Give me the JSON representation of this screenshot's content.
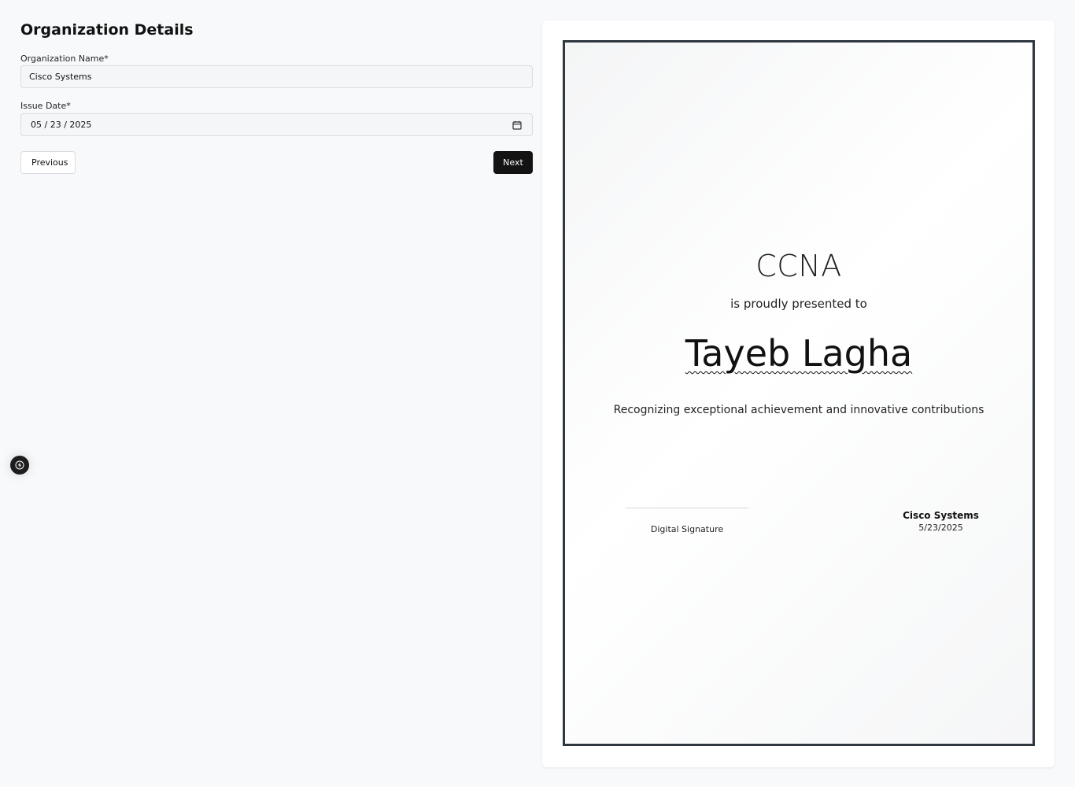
{
  "form": {
    "title": "Organization Details",
    "org_name_label": "Organization Name*",
    "org_name_value": "Cisco Systems",
    "issue_date_label": "Issue Date*",
    "issue_date_value": "05 / 23 / 2025",
    "previous_label": "Previous",
    "next_label": "Next"
  },
  "certificate": {
    "title": "CCNA",
    "presented_text": "is proudly presented to",
    "recipient_name": "Tayeb Lagha",
    "description": "Recognizing exceptional achievement and innovative contributions",
    "signature_label": "Digital Signature",
    "organization": "Cisco Systems",
    "date": "5/23/2025"
  },
  "icons": {
    "calendar": "calendar-icon",
    "fab": "lightning-icon"
  },
  "colors": {
    "background": "#f8f9fb",
    "primary_button": "#131313",
    "certificate_border": "#2f3740"
  }
}
